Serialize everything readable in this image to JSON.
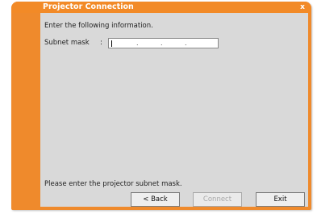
{
  "window": {
    "title": "Projector Connection",
    "close_glyph": "x"
  },
  "content": {
    "instruction": "Enter the following information.",
    "subnet_label": "Subnet mask",
    "subnet_colon": ":",
    "subnet_value": "",
    "subnet_separator": ".",
    "status_text": "Please enter the projector subnet mask."
  },
  "buttons": {
    "back": "< Back",
    "connect": "Connect",
    "exit": "Exit"
  },
  "colors": {
    "accent": "#ef8a2c",
    "panel": "#d9d9d9"
  }
}
